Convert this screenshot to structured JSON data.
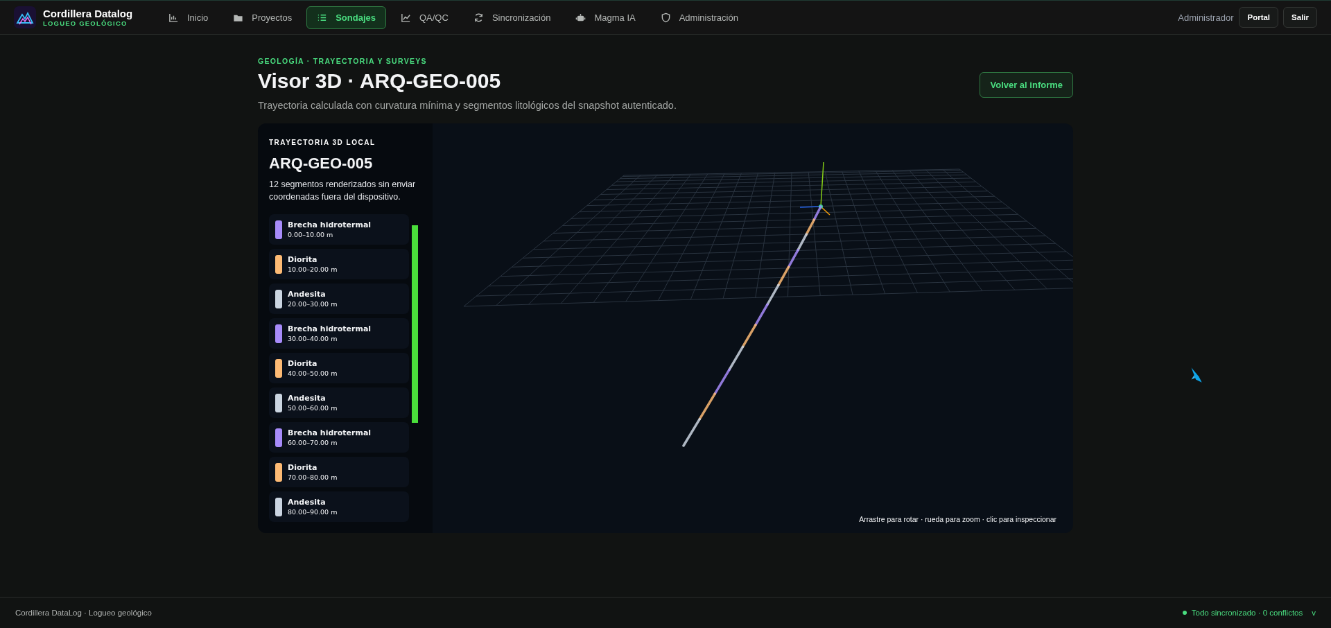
{
  "app": {
    "name": "Cordillera Datalog",
    "subtitle": "LOGUEO GEOLÓGICO"
  },
  "nav": [
    {
      "label": "Inicio",
      "selected": false
    },
    {
      "label": "Proyectos",
      "selected": false
    },
    {
      "label": "Sondajes",
      "selected": true
    },
    {
      "label": "QA/QC",
      "selected": false
    },
    {
      "label": "Sincronización",
      "selected": false
    },
    {
      "label": "Magma IA",
      "selected": false
    },
    {
      "label": "Administración",
      "selected": false
    }
  ],
  "user": "Administrador",
  "header_buttons": [
    "Portal",
    "Salir"
  ],
  "page": {
    "eyebrow": "GEOLOGÍA · TRAYECTORIA Y SURVEYS",
    "title": "Visor 3D · ARQ-GEO-005",
    "subtitle": "Trayectoria calculada con curvatura mínima y segmentos litológicos del snapshot autenticado.",
    "back_button": "Volver al informe"
  },
  "panel": {
    "eyebrow": "TRAYECTORIA 3D LOCAL",
    "title": "ARQ-GEO-005",
    "description": "12 segmentos renderizados sin enviar coordenadas fuera del dispositivo.",
    "segments": [
      {
        "name": "Brecha hidrotermal",
        "range": "0.00–10.00 m",
        "color": "#a78bfa"
      },
      {
        "name": "Diorita",
        "range": "10.00–20.00 m",
        "color": "#fdba74"
      },
      {
        "name": "Andesita",
        "range": "20.00–30.00 m",
        "color": "#cbd5e1"
      },
      {
        "name": "Brecha hidrotermal",
        "range": "30.00–40.00 m",
        "color": "#a78bfa"
      },
      {
        "name": "Diorita",
        "range": "40.00–50.00 m",
        "color": "#fdba74"
      },
      {
        "name": "Andesita",
        "range": "50.00–60.00 m",
        "color": "#cbd5e1"
      },
      {
        "name": "Brecha hidrotermal",
        "range": "60.00–70.00 m",
        "color": "#a78bfa"
      },
      {
        "name": "Diorita",
        "range": "70.00–80.00 m",
        "color": "#fdba74"
      },
      {
        "name": "Andesita",
        "range": "80.00–90.00 m",
        "color": "#cbd5e1"
      }
    ]
  },
  "viewer": {
    "hint": "Arrastre para rotar · rueda para zoom · clic para inspeccionar"
  },
  "footer": {
    "left": "Cordillera DataLog · Logueo geológico",
    "status": "Todo sincronizado · 0 conflictos",
    "caret": "v"
  }
}
